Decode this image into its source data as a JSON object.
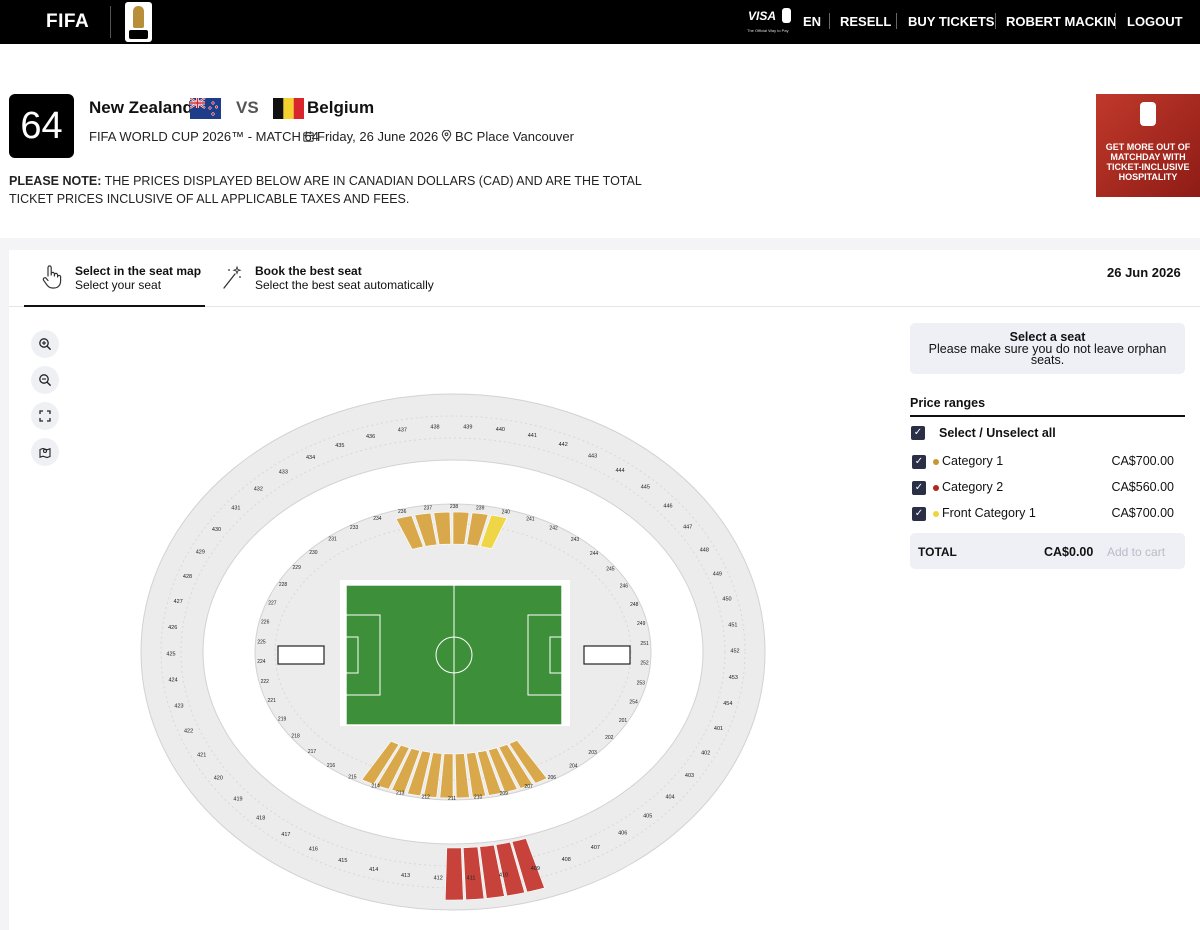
{
  "header": {
    "brand": "FIFA",
    "visa": {
      "word": "VISA",
      "tagline": "The Official Way to Pay"
    },
    "nav": [
      "EN",
      "RESELL",
      "BUY TICKETS",
      "ROBERT MACKIN",
      "LOGOUT"
    ]
  },
  "match": {
    "number": "64",
    "home_team": "New Zealand",
    "vs": "VS",
    "away_team": "Belgium",
    "competition": "FIFA WORLD CUP 2026™  - MATCH 64",
    "date": "Friday, 26 June 2026",
    "venue": "BC Place Vancouver"
  },
  "note": {
    "label": "PLEASE NOTE:",
    "text": " THE PRICES DISPLAYED BELOW ARE IN CANADIAN DOLLARS (CAD) AND ARE THE TOTAL TICKET PRICES INCLUSIVE OF ALL APPLICABLE TAXES AND FEES."
  },
  "promo": {
    "text": "GET MORE OUT OF MATCHDAY WITH TICKET-INCLUSIVE HOSPITALITY"
  },
  "tabs": [
    {
      "title": "Select in the seat map",
      "subtitle": "Select your seat"
    },
    {
      "title": "Book the best seat",
      "subtitle": "Select the best seat automatically"
    }
  ],
  "date_short": "26 Jun 2026",
  "select_box": {
    "title": "Select a seat",
    "subtitle": "Please make sure you do not leave orphan seats."
  },
  "price_ranges": {
    "heading": "Price ranges",
    "select_all": "Select / Unselect all",
    "items": [
      {
        "label": "Category 1",
        "price": "CA$700.00",
        "color": "#c9962f"
      },
      {
        "label": "Category 2",
        "price": "CA$560.00",
        "color": "#b3261e"
      },
      {
        "label": "Front Category 1",
        "price": "CA$700.00",
        "color": "#f2d33c"
      }
    ]
  },
  "total": {
    "label": "TOTAL",
    "value": "CA$0.00",
    "button": "Add to cart"
  },
  "seat_map": {
    "upper_sections": [
      "436",
      "437",
      "438",
      "439",
      "440",
      "441",
      "442",
      "443",
      "444",
      "445",
      "446",
      "447",
      "448",
      "449",
      "450",
      "451",
      "452",
      "453",
      "454",
      "401",
      "402",
      "403",
      "404",
      "405",
      "406",
      "407",
      "408",
      "409",
      "410",
      "411",
      "412",
      "413",
      "414",
      "415",
      "416",
      "417",
      "418",
      "419",
      "420",
      "421",
      "422",
      "423",
      "424",
      "425",
      "426",
      "427",
      "428",
      "429",
      "430",
      "431",
      "432",
      "433",
      "434",
      "435"
    ],
    "lower_sections": [
      "233",
      "234",
      "236",
      "237",
      "238",
      "239",
      "240",
      "241",
      "242",
      "243",
      "244",
      "245",
      "246",
      "248",
      "249",
      "251",
      "252",
      "253",
      "254",
      "201",
      "202",
      "203",
      "204",
      "206",
      "207",
      "209",
      "210",
      "211",
      "212",
      "213",
      "214",
      "215",
      "216",
      "217",
      "218",
      "219",
      "221",
      "222",
      "224",
      "225",
      "226",
      "227",
      "228",
      "229",
      "230",
      "231"
    ],
    "colors": {
      "pitch": "#3e8f3a",
      "cat1": "#d9a84a",
      "cat2": "#c6423a",
      "front": "#eed646",
      "seat": "#e6e6e6"
    }
  }
}
